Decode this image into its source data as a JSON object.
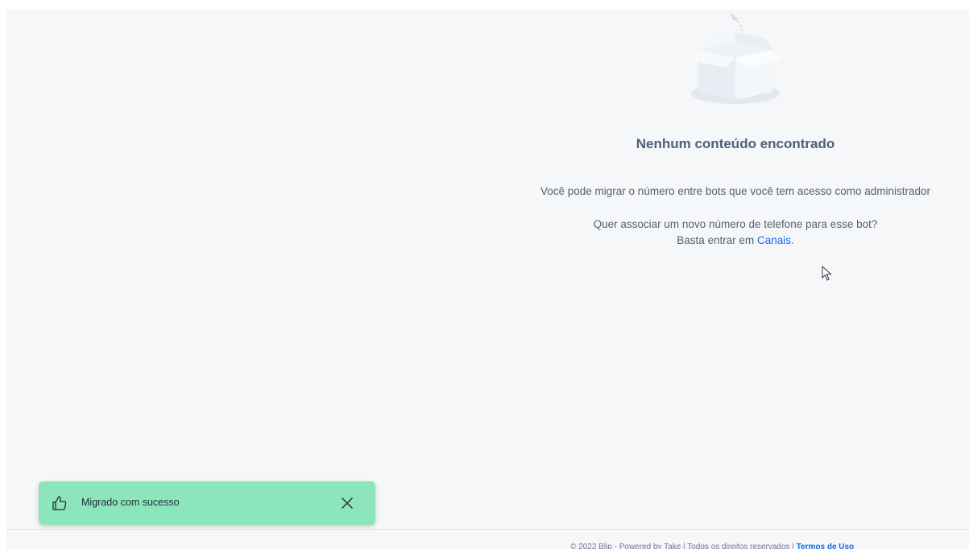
{
  "empty_state": {
    "illustration_icon": "empty-box-icon",
    "title": "Nenhum conteúdo encontrado",
    "description": "Você pode migrar o número entre bots que você tem acesso como administrador",
    "hint_line1": "Quer associar um novo número de telefone para esse bot?",
    "hint_line2_prefix": "Basta entrar em ",
    "hint_link": "Canais."
  },
  "footer": {
    "text": "© 2022 Blip - Powered by Take | Todos os direitos reservados | ",
    "link": "Termos de Uso"
  },
  "toast": {
    "icon": "thumbs-up-icon",
    "message": "Migrado com sucesso",
    "close_icon": "close-icon",
    "color": "#8de6bb"
  },
  "colors": {
    "background": "#f5f7f9",
    "link": "#1968f0",
    "title": "#505f79"
  }
}
